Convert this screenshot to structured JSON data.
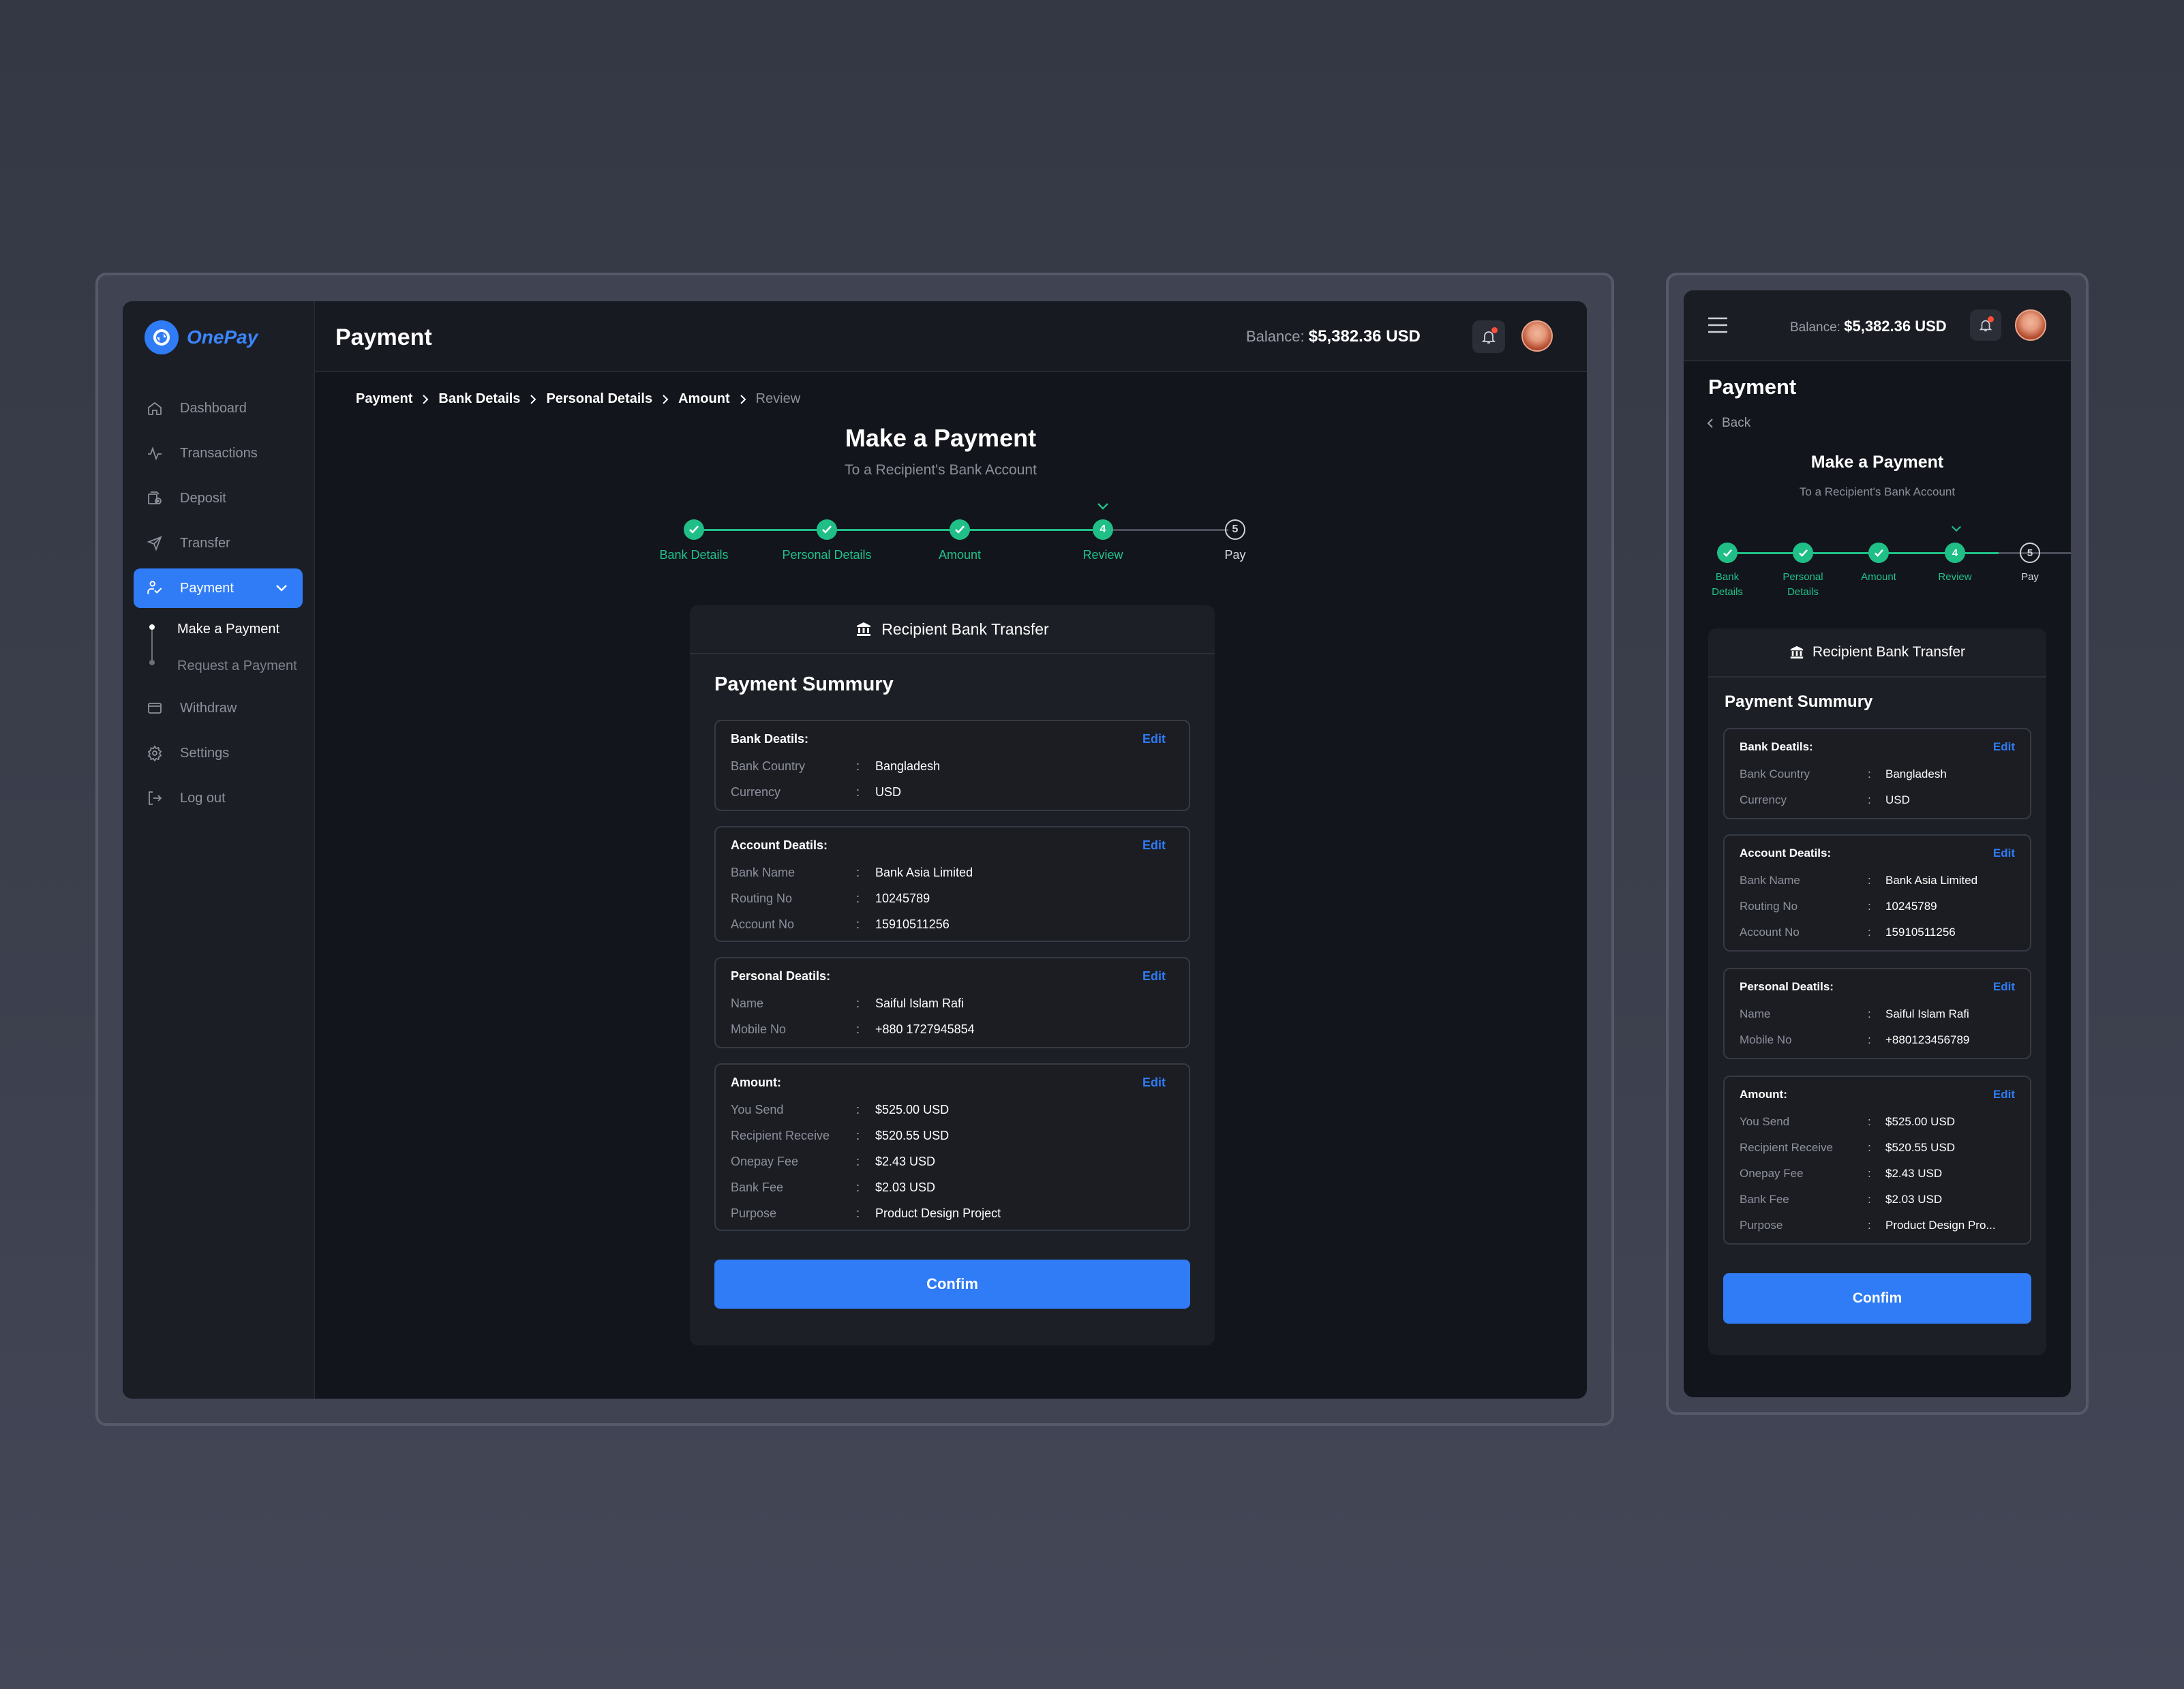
{
  "app": {
    "name": "OnePay",
    "page_title": "Payment"
  },
  "sidebar": {
    "items": [
      {
        "label": "Dashboard",
        "icon": "home-icon"
      },
      {
        "label": "Transactions",
        "icon": "activity-icon"
      },
      {
        "label": "Deposit",
        "icon": "deposit-icon"
      },
      {
        "label": "Transfer",
        "icon": "send-icon"
      },
      {
        "label": "Payment",
        "icon": "payment-icon"
      },
      {
        "label": "Withdraw",
        "icon": "wallet-icon"
      },
      {
        "label": "Settings",
        "icon": "gear-icon"
      },
      {
        "label": "Log out",
        "icon": "logout-icon"
      }
    ],
    "sub_items": [
      "Make a Payment",
      "Request a Payment"
    ]
  },
  "header": {
    "balance_label": "Balance:",
    "balance_value": "$5,382.36 USD"
  },
  "breadcrumb": [
    "Payment",
    "Bank Details",
    "Personal Details",
    "Amount",
    "Review"
  ],
  "heading": {
    "title": "Make a Payment",
    "subtitle": "To a Recipient's Bank Account"
  },
  "steps": [
    "Bank Details",
    "Personal Details",
    "Amount",
    "Review",
    "Pay"
  ],
  "step_numbers": [
    "4",
    "5"
  ],
  "mobile_steps": [
    [
      "Bank",
      "Details"
    ],
    [
      "Personal",
      "Details"
    ],
    [
      "Amount"
    ],
    [
      "Review"
    ],
    [
      "Pay"
    ]
  ],
  "card": {
    "header": "Recipient Bank Transfer",
    "title": "Payment Summury",
    "edit_label": "Edit",
    "separator": ":",
    "confirm_label": "Confim",
    "sections": {
      "bank": {
        "title": "Bank Deatils:",
        "rows": [
          {
            "k": "Bank Country",
            "v": "Bangladesh"
          },
          {
            "k": "Currency",
            "v": "USD"
          }
        ]
      },
      "account": {
        "title": "Account Deatils:",
        "rows": [
          {
            "k": "Bank Name",
            "v": "Bank Asia Limited"
          },
          {
            "k": "Routing No",
            "v": "10245789"
          },
          {
            "k": "Account No",
            "v": "15910511256"
          }
        ]
      },
      "personal": {
        "title": "Personal Deatils:",
        "rows": [
          {
            "k": "Name",
            "v": "Saiful Islam Rafi"
          },
          {
            "k": "Mobile No",
            "v": "+880 1727945854"
          }
        ]
      },
      "amount": {
        "title": "Amount:",
        "rows": [
          {
            "k": "You Send",
            "v": "$525.00 USD"
          },
          {
            "k": "Recipient Receive",
            "v": "$520.55 USD"
          },
          {
            "k": "Onepay Fee",
            "v": "$2.43 USD"
          },
          {
            "k": "Bank Fee",
            "v": "$2.03 USD"
          },
          {
            "k": "Purpose",
            "v": "Product Design Project"
          }
        ]
      }
    }
  },
  "mobile": {
    "back_label": "Back",
    "mobile_no": "+880123456789",
    "purpose": "Product Design Pro..."
  },
  "colors": {
    "accent": "#2f7cf6",
    "success": "#1fbf87",
    "background": "#13151c",
    "surface": "#1d1f26"
  }
}
